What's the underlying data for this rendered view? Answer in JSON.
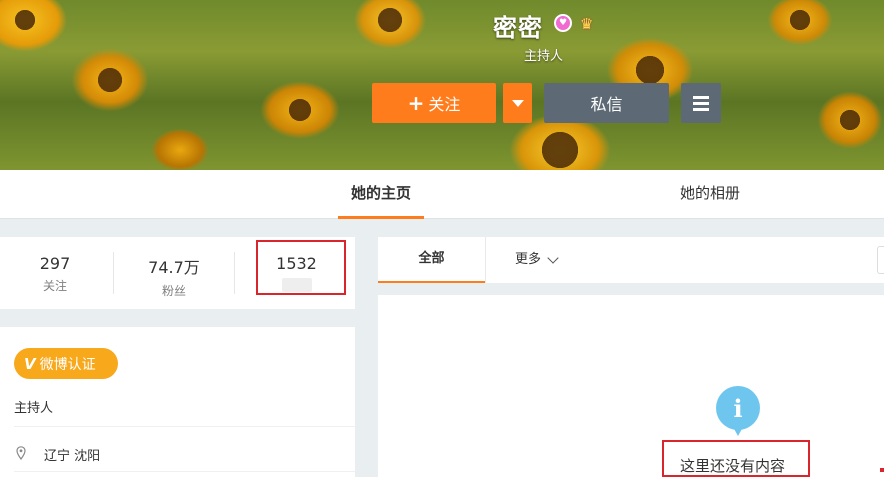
{
  "profile": {
    "name": "密密",
    "description": "主持人",
    "follow_button": "关注",
    "message_button": "私信"
  },
  "tabs": {
    "home": "她的主页",
    "album": "她的相册"
  },
  "stats": {
    "following_count": "297",
    "following_label": "关注",
    "fans_count": "74.7万",
    "fans_label": "粉丝",
    "weibo_count": "1532"
  },
  "info": {
    "verified_badge": "微博认证",
    "verified_desc": "主持人",
    "location": "辽宁 沈阳"
  },
  "feed": {
    "tab_all": "全部",
    "tab_more": "更多",
    "empty_message": "这里还没有内容"
  },
  "colors": {
    "accent": "#ff7c1c",
    "secondary_button": "#5d6a75",
    "verified": "#f8a81b",
    "highlight": "#d9262d",
    "info_icon": "#6ec6ee"
  }
}
